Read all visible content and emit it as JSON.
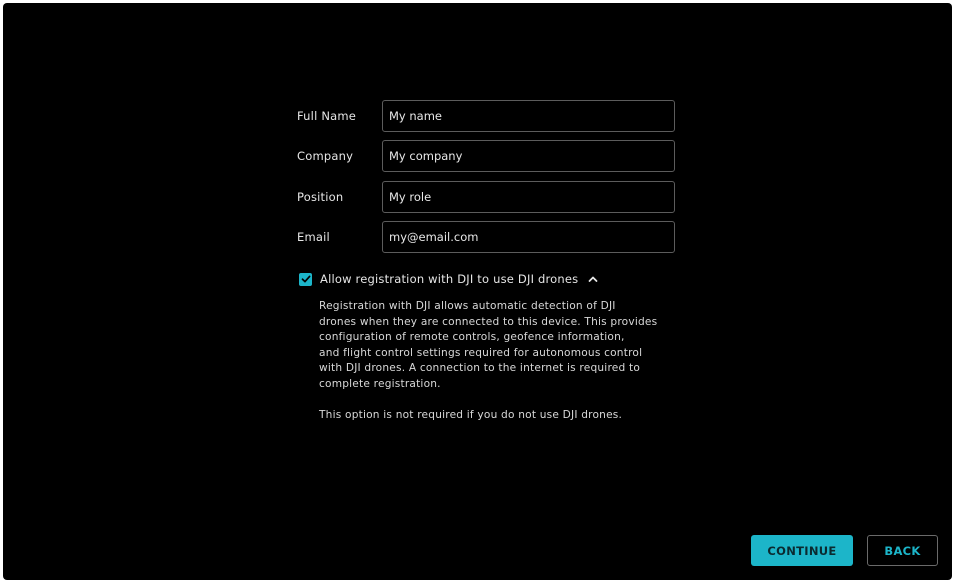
{
  "form": {
    "full_name": {
      "label": "Full Name",
      "value": "My name"
    },
    "company": {
      "label": "Company",
      "value": "My company"
    },
    "position": {
      "label": "Position",
      "value": "My role"
    },
    "email": {
      "label": "Email",
      "value": "my@email.com"
    }
  },
  "dji": {
    "checkbox_label": "Allow registration with DJI to use DJI drones",
    "checked": true,
    "description_lines": [
      "Registration with DJI allows automatic detection of DJI",
      "drones when they are connected to this device. This provides",
      "configuration of remote controls, geofence information,",
      "and flight control settings required for autonomous control",
      "with DJI drones. A connection to the internet is required to",
      "complete registration."
    ],
    "note": "This option is not required if you do not use DJI drones."
  },
  "buttons": {
    "continue": "CONTINUE",
    "back": "BACK"
  },
  "colors": {
    "accent": "#1cb5c9",
    "background": "#000000",
    "input_border": "#5c5c5c"
  },
  "icons": {
    "checkbox": "check-icon",
    "expand_toggle": "chevron-up-icon"
  }
}
